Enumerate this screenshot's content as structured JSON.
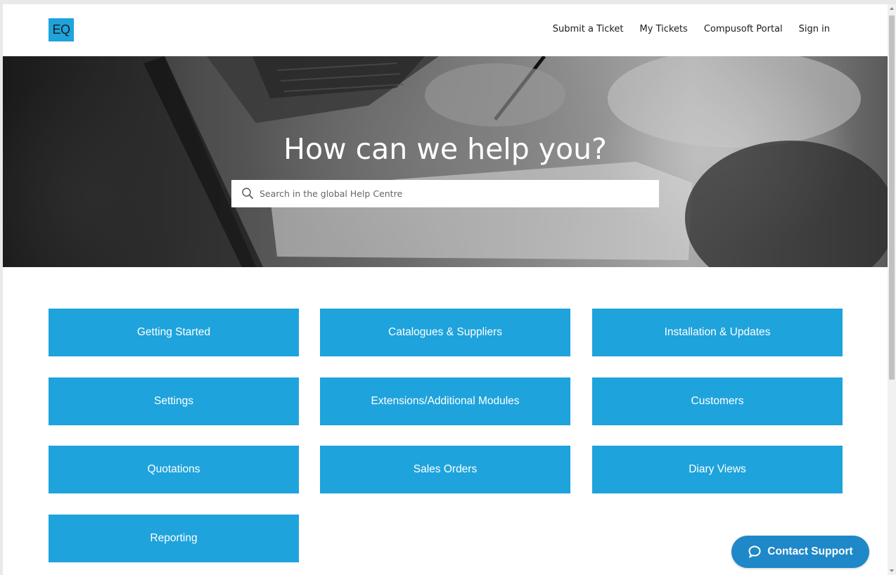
{
  "logo": {
    "text": "EQ"
  },
  "nav": {
    "items": [
      {
        "label": "Submit a Ticket"
      },
      {
        "label": "My Tickets"
      },
      {
        "label": "Compusoft Portal"
      },
      {
        "label": "Sign in"
      }
    ]
  },
  "hero": {
    "title": "How can we help you?",
    "search": {
      "placeholder": "Search in the global Help Centre",
      "value": ""
    }
  },
  "categories": [
    {
      "label": "Getting Started"
    },
    {
      "label": "Catalogues & Suppliers"
    },
    {
      "label": "Installation & Updates"
    },
    {
      "label": "Settings"
    },
    {
      "label": "Extensions/Additional Modules"
    },
    {
      "label": "Customers"
    },
    {
      "label": "Quotations"
    },
    {
      "label": "Sales Orders"
    },
    {
      "label": "Diary Views"
    },
    {
      "label": "Reporting"
    }
  ],
  "contact_support": {
    "label": "Contact Support",
    "icon": "chat-bubble-icon"
  },
  "colors": {
    "accent": "#1ea3dc",
    "contact_button": "#1e88c8"
  }
}
